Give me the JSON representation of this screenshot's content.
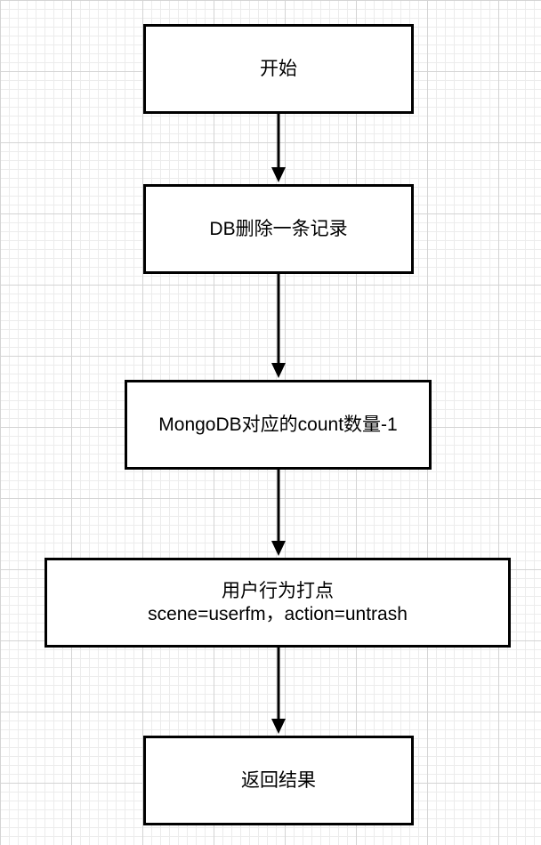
{
  "flowchart": {
    "nodes": {
      "start": {
        "label": "开始"
      },
      "db_delete": {
        "label": "DB删除一条记录"
      },
      "count": {
        "label": "MongoDB对应的count数量-1"
      },
      "track": {
        "line1": "用户行为打点",
        "line2": "scene=userfm，action=untrash"
      },
      "return": {
        "label": "返回结果"
      }
    },
    "edges": [
      {
        "from": "start",
        "to": "db_delete"
      },
      {
        "from": "db_delete",
        "to": "count"
      },
      {
        "from": "count",
        "to": "track"
      },
      {
        "from": "track",
        "to": "return"
      }
    ],
    "colors": {
      "stroke": "#000000",
      "fill": "#ffffff",
      "grid_major": "#d4d4d4",
      "grid_minor": "#ececec"
    }
  }
}
